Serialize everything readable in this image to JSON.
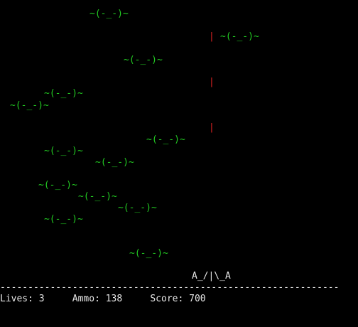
{
  "game": {
    "enemy_glyph": "~(-_-)~",
    "bullet_glyph": "|",
    "player_glyph": "A_/|\\_A",
    "divider": "-------------------------------------------------------------",
    "enemy_color": "#22c922",
    "bullet_color": "#dd2222",
    "background_color": "#000000"
  },
  "hud": {
    "lives_label": "Lives:",
    "lives_value": "3",
    "ammo_label": "Ammo:",
    "ammo_value": "138",
    "score_label": "Score:",
    "score_value": "700"
  }
}
